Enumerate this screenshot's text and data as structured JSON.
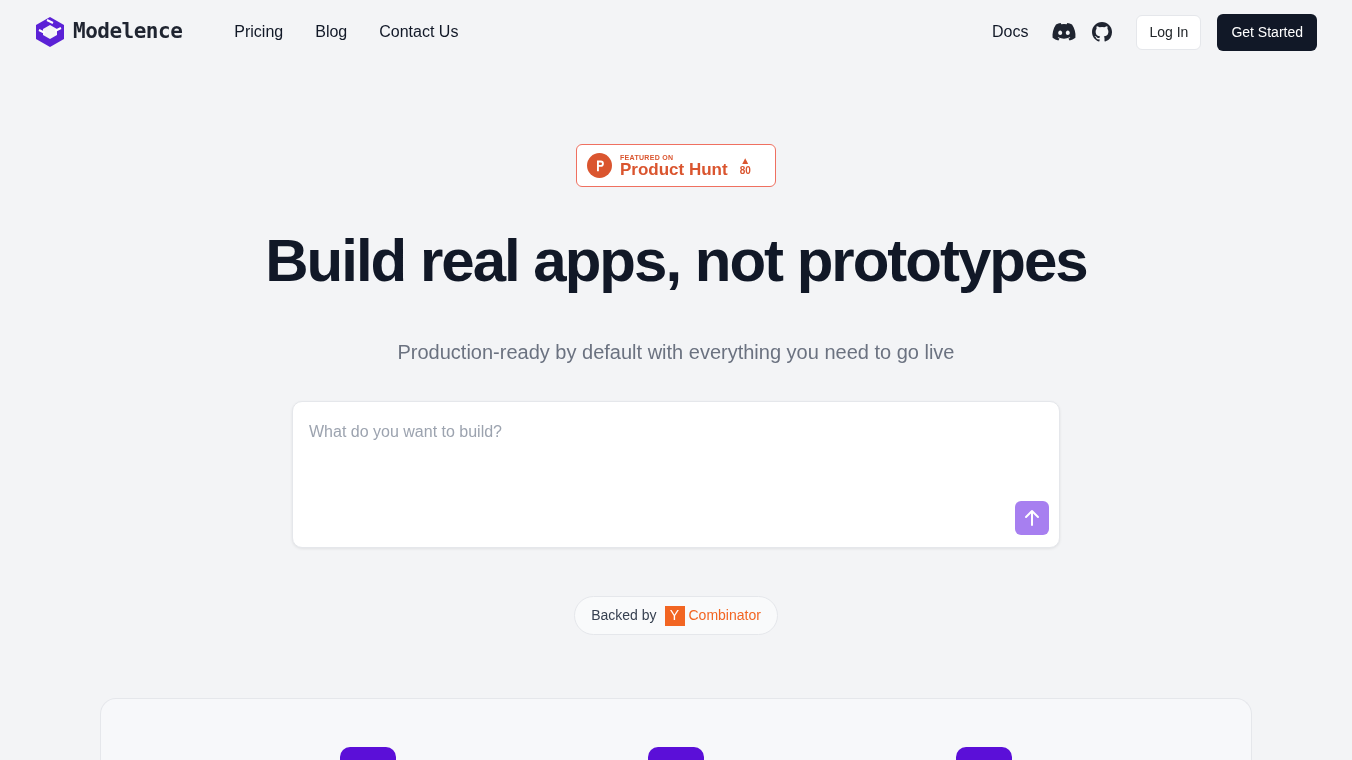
{
  "brand": {
    "name": "Modelence"
  },
  "nav_links": [
    {
      "label": "Pricing"
    },
    {
      "label": "Blog"
    },
    {
      "label": "Contact Us"
    }
  ],
  "nav_right": {
    "docs": "Docs",
    "login": "Log In",
    "cta": "Get Started"
  },
  "badge": {
    "featured": "FEATURED ON",
    "name": "Product Hunt",
    "arrow": "▲",
    "votes": "80"
  },
  "hero": {
    "title": "Build real apps, not prototypes",
    "subtitle": "Production-ready by default with everything you need to go live"
  },
  "prompt": {
    "placeholder": "What do you want to build?",
    "send_disabled": true
  },
  "backed": {
    "label": "Backed by",
    "logo": "Y",
    "name": "Combinator"
  }
}
